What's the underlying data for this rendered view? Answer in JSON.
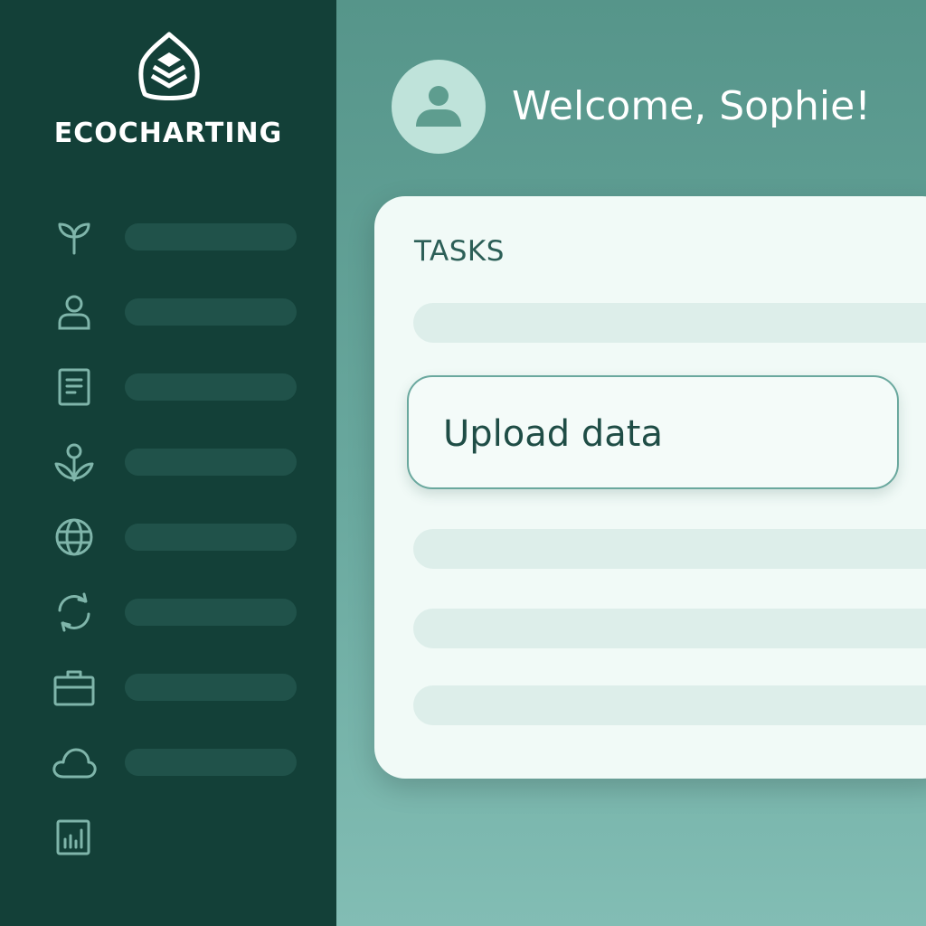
{
  "brand": {
    "name": "ECOCHARTING",
    "logo_icon": "layered-shield-logo"
  },
  "sidebar": {
    "items": [
      {
        "icon": "sprout-icon",
        "label": ""
      },
      {
        "icon": "user-icon",
        "label": ""
      },
      {
        "icon": "document-icon",
        "label": ""
      },
      {
        "icon": "plant-icon",
        "label": ""
      },
      {
        "icon": "globe-icon",
        "label": ""
      },
      {
        "icon": "refresh-icon",
        "label": ""
      },
      {
        "icon": "briefcase-icon",
        "label": ""
      },
      {
        "icon": "cloud-icon",
        "label": ""
      },
      {
        "icon": "bar-chart-icon",
        "label": ""
      }
    ]
  },
  "header": {
    "avatar_icon": "user-avatar-icon",
    "welcome_text": "Welcome, Sophie!"
  },
  "tasks": {
    "title": "TASKS",
    "upload_button_label": "Upload data"
  },
  "colors": {
    "sidebar_bg": "#134038",
    "sidebar_placeholder": "#20524a",
    "main_bg": "#5a978c",
    "card_bg": "#f1faf7",
    "accent": "#6aa89e",
    "text_dark": "#1f4d46"
  }
}
